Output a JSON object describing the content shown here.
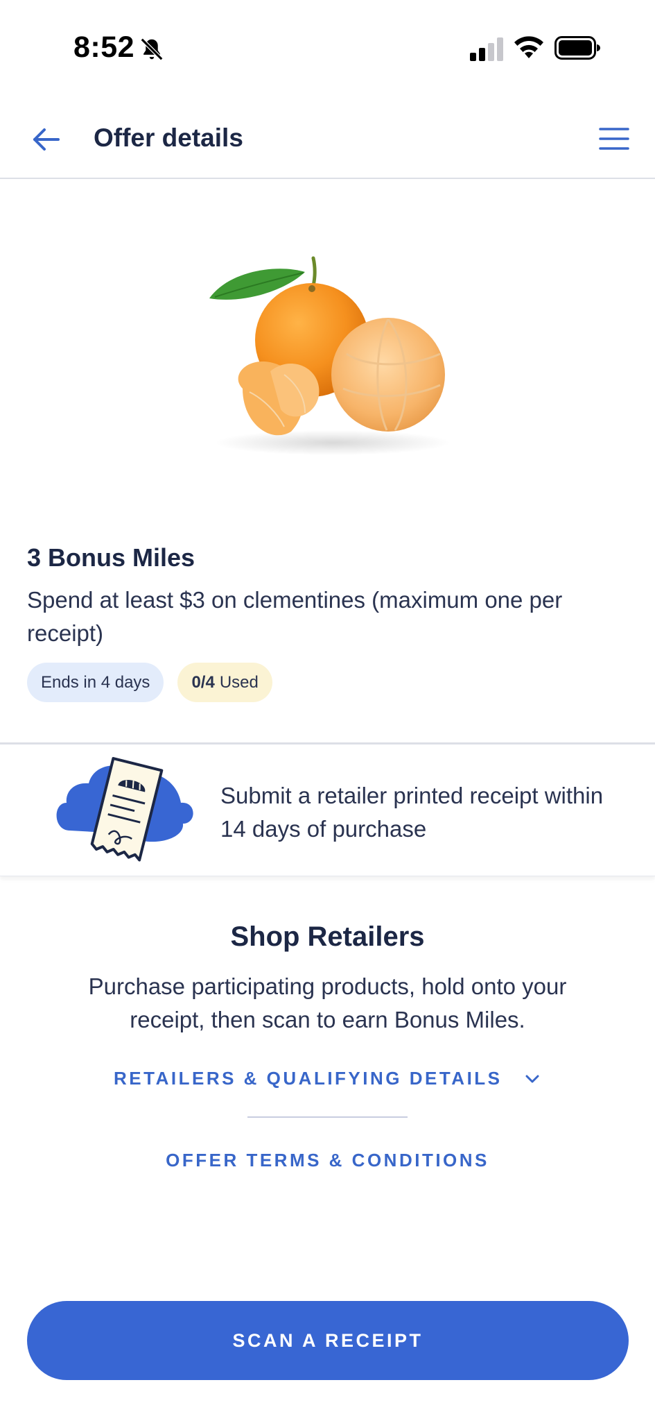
{
  "status_bar": {
    "time": "8:52",
    "icons": [
      "bell-slash-icon",
      "cellular-signal-icon",
      "wifi-icon",
      "battery-icon"
    ]
  },
  "header": {
    "title": "Offer details",
    "back_icon": "arrow-left-icon",
    "menu_icon": "hamburger-menu-icon"
  },
  "offer": {
    "image": "clementines",
    "title": "3 Bonus Miles",
    "description": "Spend at least $3 on clementines (maximum one per receipt)",
    "badge_ends": "Ends in 4 days",
    "badge_used_count": "0/4",
    "badge_used_label": "Used"
  },
  "receipt_info": {
    "illustration": "receipt-icon",
    "text": "Submit a retailer printed receipt within 14 days of purchase"
  },
  "shop": {
    "title": "Shop Retailers",
    "description": "Purchase participating products, hold onto your receipt, then scan to earn Bonus Miles.",
    "retailers_link": "RETAILERS & QUALIFYING DETAILS",
    "terms_link": "OFFER TERMS & CONDITIONS"
  },
  "scan_button": "SCAN A RECEIPT",
  "colors": {
    "primary": "#3866d3",
    "link": "#3866c9",
    "text_dark": "#1c2745",
    "badge_blue": "#e3ecfb",
    "badge_yellow": "#fbf3d4"
  }
}
